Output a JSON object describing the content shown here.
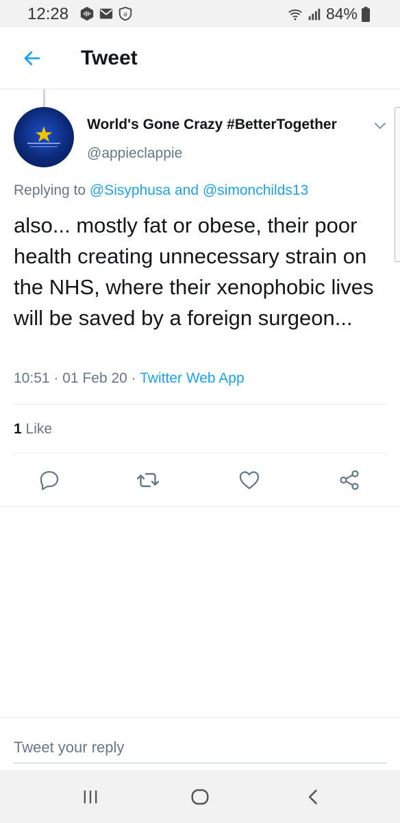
{
  "status_bar": {
    "time": "12:28",
    "battery": "84%"
  },
  "header": {
    "title": "Tweet",
    "back_icon": "arrow-left-icon"
  },
  "tweet": {
    "author_name": "World's Gone Crazy #BetterTogether",
    "author_handle": "@appieclappie",
    "replying_prefix": "Replying to",
    "replying_to_1": "@Sisyphusa",
    "replying_and": "and",
    "replying_to_2": "@simonchilds13",
    "text": "also... mostly fat or obese, their poor health creating unnecessary strain on the NHS, where their xenophobic lives will be saved by a foreign surgeon...",
    "time": "10:51",
    "date": "01 Feb 20",
    "source": "Twitter Web App",
    "like_count": "1",
    "like_label": "Like"
  },
  "actions": [
    "reply-icon",
    "retweet-icon",
    "like-icon",
    "share-icon"
  ],
  "reply": {
    "placeholder": "Tweet your reply"
  },
  "colors": {
    "accent": "#1da1f2",
    "secondary_text": "#657786",
    "primary_text": "#14171a"
  }
}
